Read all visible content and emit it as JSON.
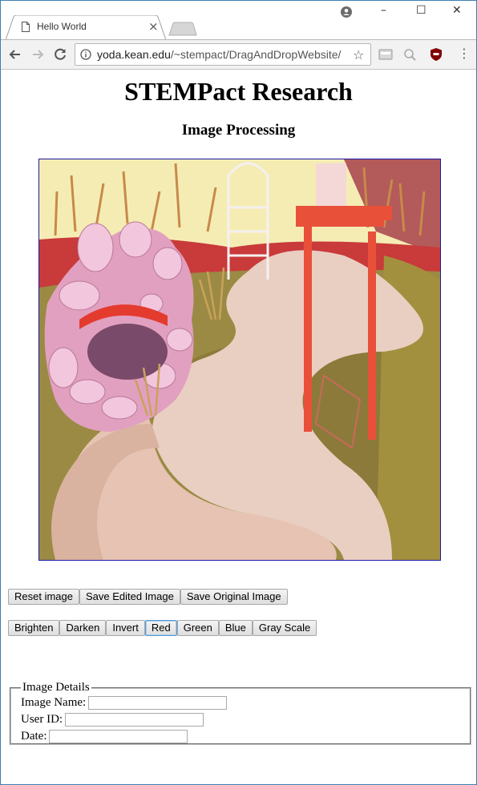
{
  "browser": {
    "tab_title": "Hello World",
    "tab_close": "×",
    "window_minimize": "–",
    "window_maximize": "☐",
    "window_close": "✕",
    "url_host": "yoda.kean.edu",
    "url_path": "/~stempact/DragAndDropWebsite/",
    "star": "☆",
    "menu": "⋮",
    "icons": [
      "page-icon",
      "profile-icon",
      "back-icon",
      "forward-icon",
      "reload-icon",
      "info-icon",
      "star-icon",
      "extension-icon",
      "search-extension-icon",
      "ublock-icon",
      "menu-icon"
    ]
  },
  "page": {
    "title": "STEMPact Research",
    "subtitle": "Image Processing",
    "image_description_colors": {
      "sky": "#f5eeb0",
      "grass": "#9a8a42",
      "path": "#e8c2b2",
      "arbor": "#e8503a",
      "rocks": "#e8a8c8"
    },
    "file_buttons": [
      "Reset image",
      "Save Edited Image",
      "Save Original Image"
    ],
    "filter_buttons": [
      "Brighten",
      "Darken",
      "Invert",
      "Red",
      "Green",
      "Blue",
      "Gray Scale"
    ],
    "focused_filter": "Red",
    "details": {
      "legend": "Image Details",
      "fields": [
        {
          "label": "Image Name:",
          "value": ""
        },
        {
          "label": "User ID:",
          "value": ""
        },
        {
          "label": "Date:",
          "value": ""
        }
      ]
    }
  }
}
